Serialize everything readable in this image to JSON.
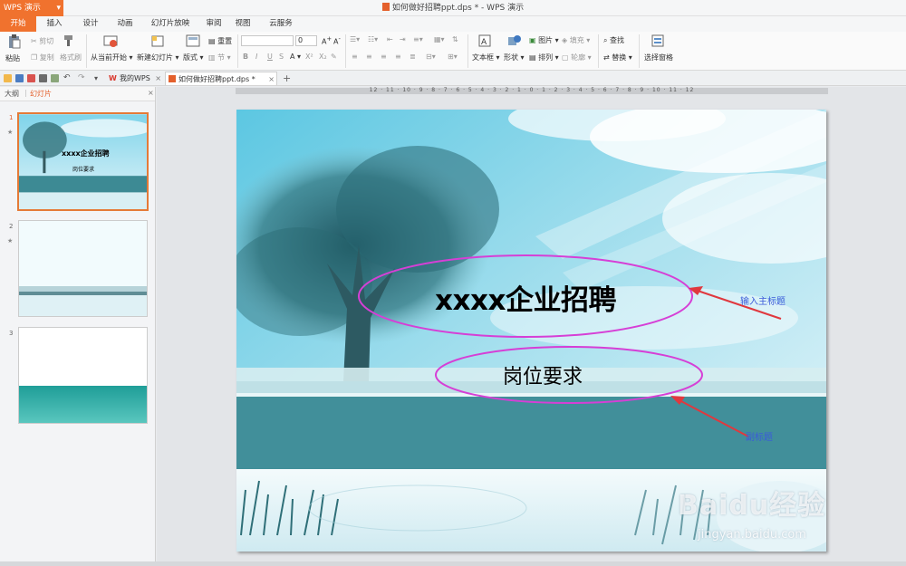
{
  "window": {
    "app_button": "WPS 演示",
    "title": "如何做好招聘ppt.dps * - WPS 演示"
  },
  "ribbon_tabs": [
    "开始",
    "插入",
    "设计",
    "动画",
    "幻灯片放映",
    "审阅",
    "视图",
    "云服务"
  ],
  "ribbon": {
    "paste": "粘贴",
    "cut": "剪切",
    "copy": "复制",
    "format_painter": "格式刷",
    "from_current": "从当前开始",
    "new_slide": "新建幻灯片",
    "layout": "版式",
    "reset": "重置",
    "section": "节",
    "font_size": "0",
    "textbox": "文本框",
    "shape": "形状",
    "picture": "图片",
    "fill": "填充",
    "arrange": "排列",
    "outline": "轮廓",
    "find": "查找",
    "replace": "替换",
    "select_pane": "选择窗格"
  },
  "doc_tabs": {
    "my_wps": "我的WPS",
    "document": "如何做好招聘ppt.dps *"
  },
  "left_panel": {
    "tab_outline": "大纲",
    "tab_slides": "幻灯片",
    "slides": [
      {
        "num": "1",
        "title": "xxxx企业招聘",
        "subtitle": "岗位要求"
      },
      {
        "num": "2"
      },
      {
        "num": "3"
      }
    ]
  },
  "ruler": "12 · 11 · 10 · 9 · 8 · 7 · 6 · 5 · 4 · 3 · 2 · 1 · 0 · 1 · 2 · 3 · 4 · 5 · 6 · 7 · 8 · 9 · 10 · 11 · 12",
  "slide": {
    "title": "xxxx企业招聘",
    "subtitle": "岗位要求"
  },
  "annotations": {
    "main_title_hint": "输入主标题",
    "subtitle_hint": "副标题"
  },
  "watermark": {
    "brand": "Baidu经验",
    "url": "jingyan.baidu.com"
  },
  "colors": {
    "accent": "#f0722e",
    "highlight_ellipse": "#d63fd6",
    "arrow": "#e0383e",
    "annotation_text": "#3b5bd9"
  }
}
